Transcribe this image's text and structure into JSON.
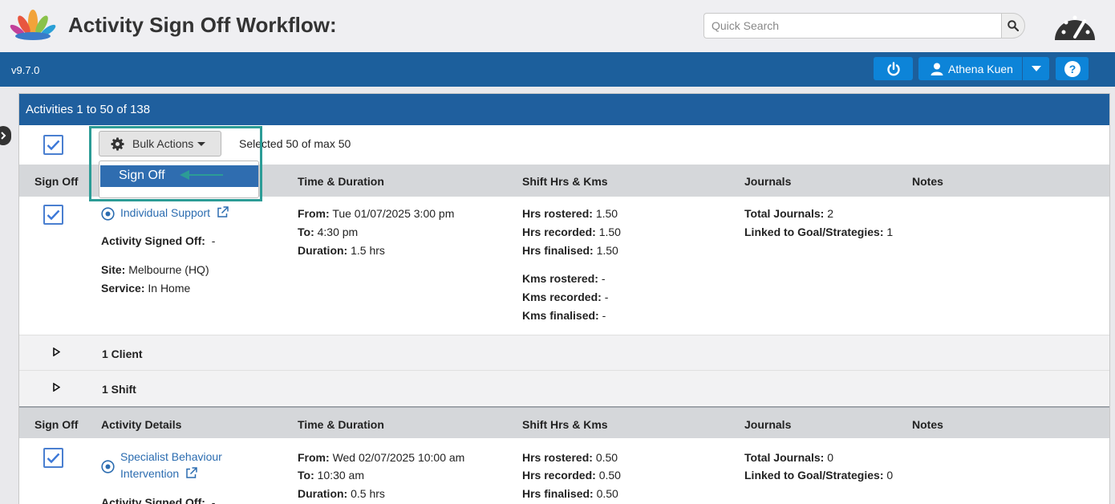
{
  "header": {
    "app_title": "Activity Sign Off Workflow:",
    "search_placeholder": "Quick Search"
  },
  "topbar": {
    "version": "v9.7.0",
    "user_name": "Athena Kuen"
  },
  "panel": {
    "title": "Activities 1 to 50 of 138",
    "bulk_actions_label": "Bulk Actions",
    "selected_text": "Selected 50 of max 50",
    "dropdown_items": [
      "Sign Off"
    ]
  },
  "columns": {
    "sign_off": "Sign Off",
    "activity_details": "Activity Details",
    "time_duration": "Time & Duration",
    "shift_hrs": "Shift Hrs & Kms",
    "journals": "Journals",
    "notes": "Notes"
  },
  "activities": [
    {
      "name": "Individual Support",
      "signed_off_label": "Activity Signed Off:",
      "signed_off_value": "-",
      "site_label": "Site:",
      "site": "Melbourne (HQ)",
      "service_label": "Service:",
      "service": "In Home",
      "from_label": "From:",
      "from": "Tue 01/07/2025 3:00 pm",
      "to_label": "To:",
      "to": "4:30 pm",
      "duration_label": "Duration:",
      "duration": "1.5 hrs",
      "hrs_rostered_label": "Hrs rostered:",
      "hrs_rostered": "1.50",
      "hrs_recorded_label": "Hrs recorded:",
      "hrs_recorded": "1.50",
      "hrs_finalised_label": "Hrs finalised:",
      "hrs_finalised": "1.50",
      "kms_rostered_label": "Kms rostered:",
      "kms_rostered": "-",
      "kms_recorded_label": "Kms recorded:",
      "kms_recorded": "-",
      "kms_finalised_label": "Kms finalised:",
      "kms_finalised": "-",
      "total_journals_label": "Total Journals:",
      "total_journals": "2",
      "linked_label": "Linked to Goal/Strategies:",
      "linked": "1",
      "clients": "1 Client",
      "shifts": "1 Shift"
    },
    {
      "name_line1": "Specialist Behaviour",
      "name_line2": "Intervention",
      "signed_off_label": "Activity Signed Off:",
      "signed_off_value": "-",
      "from_label": "From:",
      "from": "Wed 02/07/2025 10:00 am",
      "to_label": "To:",
      "to": "10:30 am",
      "duration_label": "Duration:",
      "duration": "0.5 hrs",
      "hrs_rostered_label": "Hrs rostered:",
      "hrs_rostered": "0.50",
      "hrs_recorded_label": "Hrs recorded:",
      "hrs_recorded": "0.50",
      "hrs_finalised_label": "Hrs finalised:",
      "hrs_finalised": "0.50",
      "total_journals_label": "Total Journals:",
      "total_journals": "0",
      "linked_label": "Linked to Goal/Strategies:",
      "linked": "0"
    }
  ],
  "colors": {
    "primary_blue": "#1c5f9c",
    "button_blue": "#0d84d8",
    "highlight_teal": "#2c9c96",
    "link_blue": "#2b6cb0"
  },
  "icons": [
    "lotus-logo-icon",
    "search-icon",
    "gauge-icon",
    "power-icon",
    "user-icon",
    "caret-down-icon",
    "help-icon",
    "gear-icon",
    "checkmark-icon",
    "radio-target-icon",
    "external-link-icon",
    "triangle-right-icon",
    "arrow-left-icon"
  ]
}
